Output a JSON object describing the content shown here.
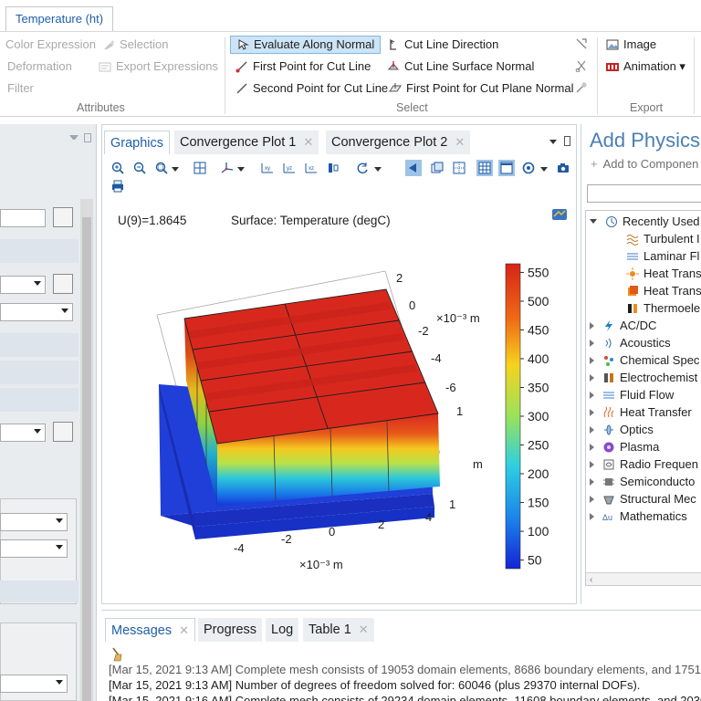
{
  "ribbon": {
    "tab_title": "Temperature (ht)",
    "attributes": {
      "color_expression": "Color Expression",
      "selection": "Selection",
      "deformation": "Deformation",
      "export_expressions": "Export Expressions",
      "filter": "Filter",
      "group_label": "Attributes"
    },
    "select": {
      "evaluate_along_normal": "Evaluate Along Normal",
      "first_point_cut_line": "First Point for Cut Line",
      "second_point_cut_line": "Second Point for Cut Line",
      "cut_line_direction": "Cut Line Direction",
      "cut_line_surface_normal": "Cut Line Surface Normal",
      "first_point_cut_plane_normal": "First Point for Cut Plane Normal",
      "group_label": "Select"
    },
    "export": {
      "image": "Image",
      "animation": "Animation ▾",
      "group_label": "Export"
    }
  },
  "graphics": {
    "tabs": [
      "Graphics",
      "Convergence Plot 1",
      "Convergence Plot 2"
    ],
    "parameter_text": "U(9)=1.8645",
    "surface_title": "Surface: Temperature (degC)",
    "colorbar_ticks": [
      "550",
      "500",
      "450",
      "400",
      "350",
      "300",
      "250",
      "200",
      "150",
      "100",
      "50"
    ],
    "colorbar_range": [
      35,
      565
    ],
    "x_ticks": [
      "-4",
      "-2",
      "0",
      "2",
      "4"
    ],
    "x_unit": "×10⁻³ m",
    "y_ticks": [
      "2",
      "0",
      "-2",
      "-4",
      "-6"
    ],
    "y_unit": "×10⁻³ m",
    "z_ticks": [
      "1",
      "1"
    ],
    "z_unit": "m"
  },
  "physics": {
    "title": "Add Physics",
    "add_to_component": "Add to Componen",
    "recently_used_label": "Recently Used",
    "recently_used": [
      "Turbulent I",
      "Laminar Fl",
      "Heat Trans",
      "Heat Trans",
      "Thermoele"
    ],
    "categories": [
      "AC/DC",
      "Acoustics",
      "Chemical Spec",
      "Electrochemist",
      "Fluid Flow",
      "Heat Transfer",
      "Optics",
      "Plasma",
      "Radio Frequen",
      "Semiconducto",
      "Structural Mec",
      "Mathematics"
    ]
  },
  "messages": {
    "tabs": [
      "Messages",
      "Progress",
      "Log",
      "Table 1"
    ],
    "lines": [
      "[Mar 15, 2021 9:13 AM] Complete mesh consists of 19053 domain elements, 8686 boundary elements, and 1751 ec",
      "[Mar 15, 2021 9:13 AM] Number of degrees of freedom solved for: 60046 (plus 29370 internal DOFs).",
      "[Mar 15, 2021 9:16 AM] Complete mesh consists of 29234 domain elements, 11608 boundary elements, and 2030 e"
    ]
  },
  "colors": {
    "accent_blue": "#1f5fa8",
    "physics_title": "#4a7fb5",
    "hot_red": "#d8281e",
    "cold_blue": "#1436d8"
  }
}
